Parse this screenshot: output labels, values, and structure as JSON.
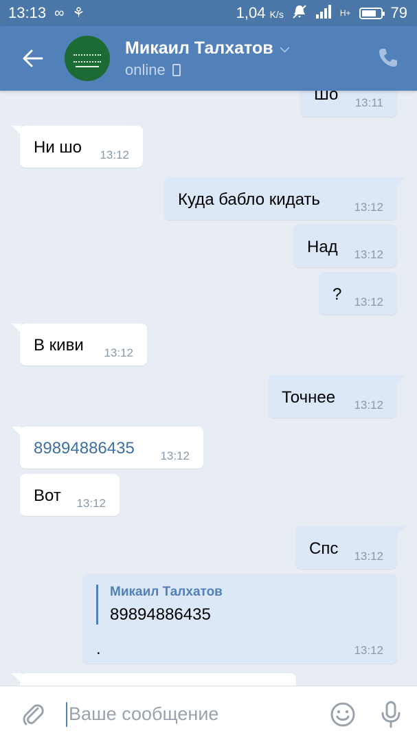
{
  "statusbar": {
    "time": "13:13",
    "speed": "1,04",
    "speed_unit": "K/s",
    "network": "H+",
    "battery": "79",
    "battery_level_percent": 79
  },
  "header": {
    "contact_name": "Микаил Талхатов",
    "status": "online"
  },
  "messages": [
    {
      "dir": "out",
      "text": "Шо",
      "time": "13:11"
    },
    {
      "dir": "in",
      "text": "Ни шо",
      "time": "13:12"
    },
    {
      "dir": "out",
      "text": "Куда бабло кидать",
      "time": "13:12"
    },
    {
      "dir": "out",
      "text": "Над",
      "time": "13:12"
    },
    {
      "dir": "out",
      "text": "?",
      "time": "13:12"
    },
    {
      "dir": "in",
      "text": "В киви",
      "time": "13:12"
    },
    {
      "dir": "out",
      "text": "Точнее",
      "time": "13:12"
    },
    {
      "dir": "in",
      "text": "89894886435",
      "time": "13:12"
    },
    {
      "dir": "in",
      "text": "Вот",
      "time": "13:12"
    },
    {
      "dir": "out",
      "text": "Спс",
      "time": "13:12"
    },
    {
      "dir": "out",
      "quote_name": "Микаил Талхатов",
      "quote_text": "89894886435",
      "text": ".",
      "time": "13:12"
    }
  ],
  "composer": {
    "placeholder": "Ваше сообщение"
  },
  "colors": {
    "header_bg": "#5181b8",
    "statusbar_bg": "#4a76a8",
    "chat_bg": "#e8edf3",
    "bubble_in": "#ffffff",
    "bubble_out": "#dce8f8",
    "link": "#3c6fa3"
  },
  "icons": {
    "back": "arrow-left-icon",
    "call": "phone-icon",
    "attach": "paperclip-icon",
    "emoji": "smile-icon",
    "voice": "microphone-icon"
  }
}
